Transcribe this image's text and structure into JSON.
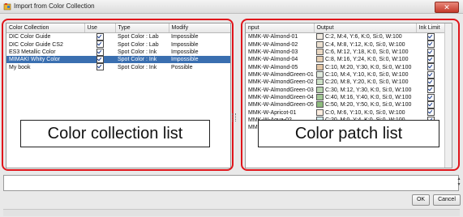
{
  "window": {
    "title": "Import from Color Collection",
    "close_symbol": "✕"
  },
  "collections": {
    "headers": [
      "Color Collection",
      "Use",
      "Type",
      "Modify"
    ],
    "rows": [
      {
        "name": "DIC Color Guide",
        "use": true,
        "type": "Spot Color : Lab",
        "modify": "Impossible",
        "selected": false
      },
      {
        "name": "DIC Color Guide CS2",
        "use": true,
        "type": "Spot Color : Lab",
        "modify": "Impossible",
        "selected": false
      },
      {
        "name": "ES3 Metallic Color",
        "use": true,
        "type": "Spot Color : Ink",
        "modify": "Impossible",
        "selected": false
      },
      {
        "name": "MIMAKI Whity Color",
        "use": true,
        "type": "Spot Color : Ink",
        "modify": "Impossible",
        "selected": true
      },
      {
        "name": "My book",
        "use": true,
        "type": "Spot Color : Ink",
        "modify": "Possible",
        "selected": false
      }
    ],
    "overlay_label": "Color collection list"
  },
  "patches": {
    "headers": [
      "nput",
      "Output",
      "Ink Limit"
    ],
    "rows": [
      {
        "input": "MMK-W-Almond-01",
        "output": "C:2, M:4, Y:6, K:0, Si:0, W:100",
        "swatch": "#f1ebe2",
        "limit": true
      },
      {
        "input": "MMK-W-Almond-02",
        "output": "C:4, M:8, Y:12, K:0, Si:0, W:100",
        "swatch": "#eee2d2",
        "limit": true
      },
      {
        "input": "MMK-W-Almond-03",
        "output": "C:6, M:12, Y:18, K:0, Si:0, W:100",
        "swatch": "#ead8c2",
        "limit": true
      },
      {
        "input": "MMK-W-Almond-04",
        "output": "C:8, M:16, Y:24, K:0, Si:0, W:100",
        "swatch": "#e6cfb3",
        "limit": true
      },
      {
        "input": "MMK-W-Almond-05",
        "output": "C:10, M:20, Y:30, K:0, Si:0, W:100",
        "swatch": "#e2c5a4",
        "limit": true
      },
      {
        "input": "MMK-W-AlmondGreen-01",
        "output": "C:10, M:4, Y:10, K:0, Si:0, W:100",
        "swatch": "#e2ecdf",
        "limit": true
      },
      {
        "input": "MMK-W-AlmondGreen-02",
        "output": "C:20, M:8, Y:20, K:0, Si:0, W:100",
        "swatch": "#cde0c6",
        "limit": true
      },
      {
        "input": "MMK-W-AlmondGreen-03",
        "output": "C:30, M:12, Y:30, K:0, Si:0, W:100",
        "swatch": "#b8d4ae",
        "limit": true
      },
      {
        "input": "MMK-W-AlmondGreen-04",
        "output": "C:40, M:16, Y:40, K:0, Si:0, W:100",
        "swatch": "#a3c896",
        "limit": true
      },
      {
        "input": "MMK-W-AlmondGreen-05",
        "output": "C:50, M:20, Y:50, K:0, Si:0, W:100",
        "swatch": "#8ebc7e",
        "limit": true
      },
      {
        "input": "MMK-W-Apricot-01",
        "output": "C:0, M:6, Y:10, K:0, Si:0, W:100",
        "swatch": "#fdeee0",
        "limit": true
      },
      {
        "input": "MMK-W-Agua-02",
        "output": "C:20, M:0, Y:4, K:0, Si:0, W:100",
        "swatch": "#d6eef0",
        "limit": true
      },
      {
        "input": "MMK-W-Agua-03",
        "output": "C:30, M:0, Y:6, K:0, Si:0, W:100",
        "swatch": "#c2e6ea",
        "limit": true
      }
    ],
    "overlay_label": "Color patch list"
  },
  "buttons": {
    "ok": "OK",
    "cancel": "Cancel"
  },
  "spinner": {
    "up": "▲",
    "down": "▼"
  },
  "colors": {
    "highlight": "#e0151b",
    "selection": "#3a6fb0"
  }
}
